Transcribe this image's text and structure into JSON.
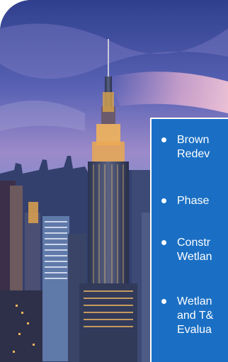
{
  "bullets": [
    {
      "lines": [
        "Brown",
        "Redev"
      ]
    },
    {
      "lines": [
        "Phase"
      ]
    },
    {
      "lines": [
        "Constr",
        "Wetlan"
      ]
    },
    {
      "lines": [
        "Wetlan",
        "and T&",
        "Evalua"
      ]
    }
  ],
  "colors": {
    "panel": "#1a6fc4",
    "text": "#ffffff",
    "sky_top": "#3b4c9a",
    "sky_mid": "#7a6fbf",
    "sky_horizon": "#c9a8d8"
  }
}
